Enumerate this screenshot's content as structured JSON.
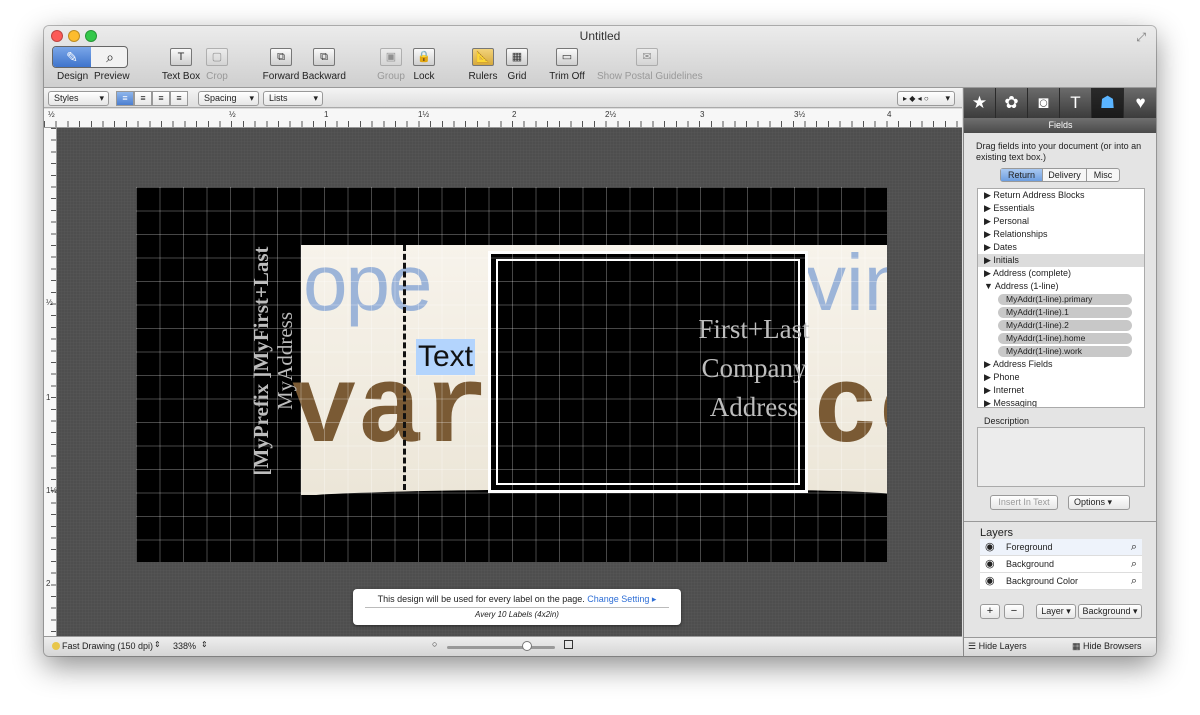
{
  "window": {
    "title": "Untitled"
  },
  "toolbar": {
    "design": "Design",
    "preview": "Preview",
    "textbox": "Text Box",
    "crop": "Crop",
    "forward": "Forward",
    "backward": "Backward",
    "group": "Group",
    "lock": "Lock",
    "rulers": "Rulers",
    "grid": "Grid",
    "trimoff": "Trim Off",
    "guidelines": "Show Postal Guidelines"
  },
  "formatbar": {
    "styles": "Styles",
    "spacing": "Spacing",
    "lists": "Lists"
  },
  "ruler": {
    "h_labels": [
      "½",
      "1",
      "1½",
      "2",
      "2½",
      "3",
      "3½",
      "4"
    ],
    "v_labels": [
      "½",
      "1",
      "1½",
      "2"
    ]
  },
  "canvas": {
    "vertical_text_line1": "[MyPrefix ]MyFirst+Last",
    "vertical_text_line2": "MyAddress",
    "text_box": "Text",
    "frame_lines": [
      "First+Last",
      "Company",
      "Address"
    ],
    "bg_word_top": "ope",
    "bg_word_top_right": "vin",
    "bg_word_bottom": "var",
    "bg_word_bottom_right": "co"
  },
  "tip": {
    "message": "This design will be used for every label on the page.",
    "link": "Change Setting ▸",
    "label_type": "Avery 10 Labels (4x2in)"
  },
  "status": {
    "drawing": "Fast Drawing (150 dpi)",
    "zoom": "338%"
  },
  "right_panel": {
    "header": "Fields",
    "hint": "Drag fields into your document (or into an existing text box.)",
    "tabs": [
      "Return",
      "Delivery",
      "Misc"
    ],
    "tree": [
      {
        "label": "Return Address Blocks",
        "expanded": false
      },
      {
        "label": "Essentials",
        "expanded": false
      },
      {
        "label": "Personal",
        "expanded": false
      },
      {
        "label": "Relationships",
        "expanded": false
      },
      {
        "label": "Dates",
        "expanded": false
      },
      {
        "label": "Initials",
        "expanded": false
      },
      {
        "label": "Address (complete)",
        "expanded": false
      },
      {
        "label": "Address (1-line)",
        "expanded": true
      },
      {
        "label": "Address Fields",
        "expanded": false
      },
      {
        "label": "Phone",
        "expanded": false
      },
      {
        "label": "Internet",
        "expanded": false
      },
      {
        "label": "Messaging",
        "expanded": false
      }
    ],
    "address_1line_children": [
      "MyAddr(1-line).primary",
      "MyAddr(1-line).1",
      "MyAddr(1-line).2",
      "MyAddr(1-line).home",
      "MyAddr(1-line).work"
    ],
    "description_label": "Description",
    "insert_btn": "Insert In Text",
    "options_btn": "Options"
  },
  "layers": {
    "title": "Layers",
    "items": [
      "Foreground",
      "Background",
      "Background Color"
    ],
    "add": "+",
    "remove": "−",
    "layer_popup": "Layer",
    "background_popup": "Background",
    "hide_layers": "Hide Layers",
    "hide_browsers": "Hide Browsers"
  },
  "colors": {
    "accent": "#2f6fd6",
    "selection": "#b3d4fd",
    "canvas": "#4e4e4e"
  }
}
